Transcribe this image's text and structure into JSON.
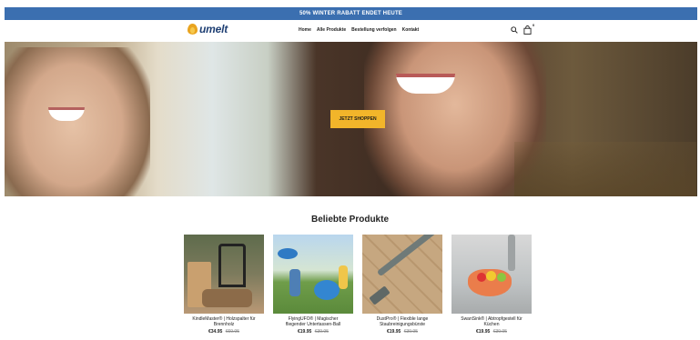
{
  "announcement": "50% WINTER RABATT ENDET HEUTE",
  "header": {
    "logo_text": "umelt",
    "nav": [
      "Home",
      "Alle Produkte",
      "Bestellung verfolgen",
      "Kontakt"
    ],
    "cart_count": "0",
    "icons": [
      "search-icon",
      "shopping-bag-icon"
    ]
  },
  "hero": {
    "cta_label": "JETZT SHOPPEN"
  },
  "section": {
    "title": "Beliebte Produkte"
  },
  "products": [
    {
      "name": "KindleMaster® | Holzspalter für Brennholz",
      "price": "€34.95",
      "old_price": "€69.95"
    },
    {
      "name": "FlyingUFO® | Magischer fliegender Untertassen-Ball",
      "price": "€19.95",
      "old_price": "€39.95"
    },
    {
      "name": "DustPro® | Flexible lange Staubreinigungsbürste",
      "price": "€19.95",
      "old_price": "€39.95"
    },
    {
      "name": "SwanSink® | Abtropfgestell für Küchen",
      "price": "€19.95",
      "old_price": "€39.95"
    }
  ],
  "colors": {
    "announcement_bg": "#3b6fb0",
    "cta_bg": "#f2b52a",
    "logo_accent": "#e9a41f",
    "logo_text": "#1e3f73"
  }
}
